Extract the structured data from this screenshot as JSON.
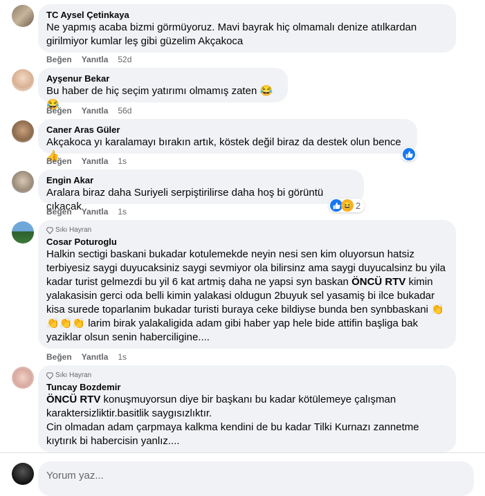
{
  "actions": {
    "like": "Beğen",
    "reply": "Yanıtla"
  },
  "comments": [
    {
      "name": "TC Aysel Çetinkaya",
      "text": "Ne yapmış acaba bizmi görmüyoruz. Mavi bayrak hiç olmamalı denize atılkardan girilmiyor kumlar leş gibi güzelim Akçakoca",
      "time": "52d"
    },
    {
      "name": "Ayşenur Bekar",
      "text": "Bu haber de hiç seçim yatırımı olmamış zaten 😂😂",
      "time": "56d"
    },
    {
      "name": "Caner Aras Güler",
      "text": "Akçakoca yı karalamayı bırakın artık, köstek değil biraz da destek olun bence 👍",
      "time": "1s",
      "reaction_icons": [
        "like-icon"
      ]
    },
    {
      "name": "Engin Akar",
      "text": "Aralara biraz daha Suriyeli serpiştirilirse daha hoş bi görüntü çıkacak",
      "time": "1s",
      "reaction_icons": [
        "like-icon",
        "haha-icon"
      ],
      "reaction_count": "2"
    },
    {
      "badge": "Sıkı Hayran",
      "name": "Cosar Poturoglu",
      "text_pre": "Halkin sectigi baskani bukadar kotulemekde neyin nesi sen kim oluyorsun hatsiz terbiyesiz saygi duyucaksiniz saygi sevmiyor ola bilirsinz ama saygi duyucalsinz bu yila kadar turist gelmezdi bu yil 6 kat artmiş daha ne yapsi syn baskan ",
      "text_bold": "ÖNCÜ RTV",
      "text_post": " kimin yalakasisin gerci oda belli kimin yalakasi oldugun 2buyuk sel yasamiş bi ilce bukadar kisa surede toparlanim bukadar turisti buraya ceke bildiyse bunda ben synbbaskani 👏👏👏👏 larim birak yalakaligida adam gibi haber yap hele bide attifin başliga bak yaziklar olsun senin haberciligine....",
      "time": "1s"
    },
    {
      "badge": "Sıkı Hayran",
      "name": "Tuncay Bozdemir",
      "text_bold": "ÖNCÜ RTV",
      "text_post": " konuşmuyorsun diye bir başkanı bu kadar kötülemeye çalışman karaktersizliktir.basitlik saygısızlıktır.\nCin olmadan adam çarpmaya kalkma kendini de bu kadar Tilki Kurnazı zannetme kıytırık bi habercisin yanlız...."
    }
  ],
  "composer": {
    "placeholder": "Yorum yaz..."
  },
  "colors": {
    "bubble": "#f0f2f5",
    "like": "#1877f2",
    "secondary_text": "#65676b"
  }
}
